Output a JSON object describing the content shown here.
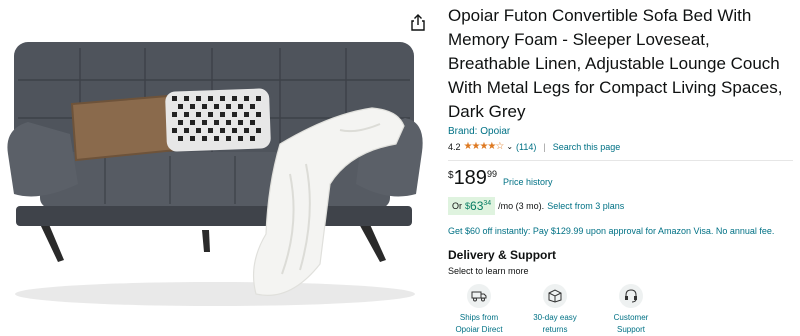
{
  "product": {
    "title": "Opoiar Futon Convertible Sofa Bed With Memory Foam - Sleeper Loveseat, Breathable Linen, Adjustable Lounge Couch With Metal Legs for Compact Living Spaces, Dark Grey",
    "brand": "Brand: Opoiar",
    "rating": "4.2",
    "stars": 4.2,
    "star_glyphs": "★★★★☆",
    "rating_count": "(114)",
    "search_link": "Search this page"
  },
  "price": {
    "currency": "$",
    "whole": "189",
    "fraction": "99",
    "history_label": "Price history"
  },
  "monthly": {
    "prefix": "Or",
    "currency": "$",
    "whole": "63",
    "fraction": "34",
    "suffix": "/mo (3 mo).",
    "plans_link": "Select from 3 plans"
  },
  "promo": {
    "text": "Get $60 off instantly: Pay $129.99 upon approval for Amazon Visa. No annual fee."
  },
  "delivery": {
    "title": "Delivery & Support",
    "subtitle": "Select to learn more",
    "items": [
      {
        "line1": "Ships from",
        "line2": "Opoiar Direct",
        "icon": "truck-icon"
      },
      {
        "line1": "30-day easy",
        "line2": "returns",
        "icon": "return-box-icon"
      },
      {
        "line1": "Customer",
        "line2": "Support",
        "icon": "headset-icon"
      }
    ]
  },
  "colors": {
    "link": "#007185",
    "star": "#de7921",
    "deal_badge": "#dff3df",
    "sofa": "#4a4f57"
  }
}
